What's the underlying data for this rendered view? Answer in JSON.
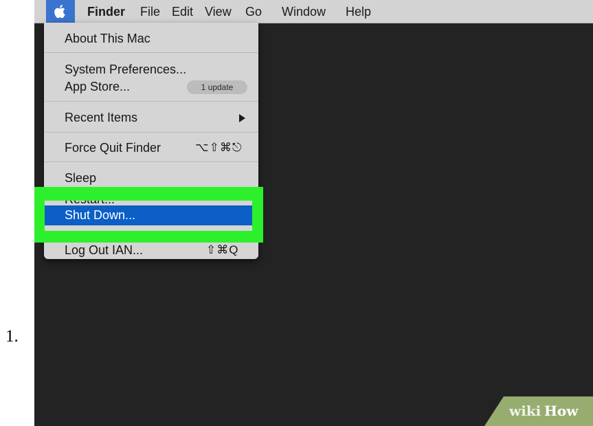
{
  "list_number": "1.",
  "menubar": {
    "apple_icon": "apple-icon",
    "items": [
      "Finder",
      "File",
      "Edit",
      "View",
      "Go",
      "Window",
      "Help"
    ]
  },
  "apple_menu": {
    "about": "About This Mac",
    "system_preferences": "System Preferences...",
    "app_store": "App Store...",
    "app_store_badge": "1 update",
    "recent_items": "Recent Items",
    "force_quit": "Force Quit Finder",
    "force_quit_shortcut": "⌥⇧⌘⎋",
    "sleep": "Sleep",
    "restart": "Restart...",
    "shut_down": "Shut Down...",
    "log_out": "Log Out IAN...",
    "log_out_shortcut": "⇧⌘Q"
  },
  "highlight_color": "#2df02c",
  "selection_color": "#0b5fc6",
  "watermark": {
    "wiki": "wiki",
    "how": "How"
  }
}
